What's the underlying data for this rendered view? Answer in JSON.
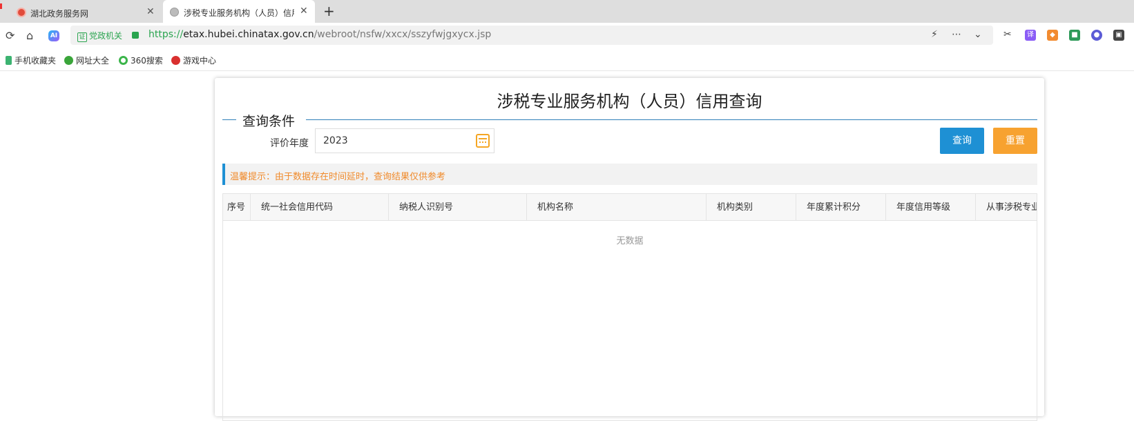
{
  "browser": {
    "tabs": [
      {
        "title": "湖北政务服务网"
      },
      {
        "title": "涉税专业服务机构（人员）信用查询"
      }
    ],
    "new_tab": "+",
    "address": {
      "badge": "党政机关",
      "url_scheme": "https://",
      "url_host": "etax.hubei.chinatax.gov.cn",
      "url_path": "/webroot/nsfw/xxcx/sszyfwjgxycx.jsp"
    },
    "bookmarks": [
      {
        "label": "手机收藏夹"
      },
      {
        "label": "网址大全"
      },
      {
        "label": "360搜索"
      },
      {
        "label": "游戏中心"
      }
    ],
    "extensions": {
      "translate": "译",
      "ai": "AI"
    }
  },
  "page": {
    "title": "涉税专业服务机构（人员）信用查询",
    "section_title": "查询条件",
    "year_label": "评价年度",
    "year_value": "2023",
    "query_button": "查询",
    "reset_button": "重置",
    "notice": "温馨提示：由于数据存在时间延时，查询结果仅供参考",
    "columns": [
      "序号",
      "统一社会信用代码",
      "纳税人识别号",
      "机构名称",
      "机构类别",
      "年度累计积分",
      "年度信用等级",
      "从事涉税专业服务人员"
    ],
    "empty_text": "无数据"
  }
}
